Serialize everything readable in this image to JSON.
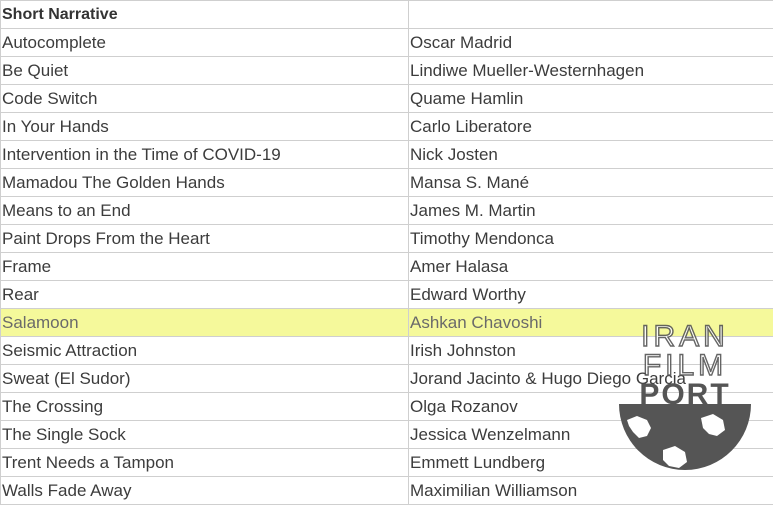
{
  "table": {
    "header": [
      "Short Narrative",
      ""
    ],
    "rows": [
      {
        "title": "Autocomplete",
        "director": "Oscar Madrid"
      },
      {
        "title": "Be Quiet",
        "director": "Lindiwe Mueller-Westernhagen"
      },
      {
        "title": "Code Switch",
        "director": "Quame Hamlin"
      },
      {
        "title": "In Your Hands",
        "director": "Carlo Liberatore"
      },
      {
        "title": "Intervention in the Time of COVID-19",
        "director": "Nick Josten"
      },
      {
        "title": "Mamadou The Golden Hands",
        "director": "Mansa S. Mané"
      },
      {
        "title": "Means to an End",
        "director": "James M. Martin"
      },
      {
        "title": "Paint Drops From the Heart",
        "director": "Timothy Mendonca"
      },
      {
        "title": "Frame",
        "director": "Amer Halasa"
      },
      {
        "title": "Rear",
        "director": "Edward Worthy"
      },
      {
        "title": "Salamoon",
        "director": "Ashkan Chavoshi"
      },
      {
        "title": "Seismic Attraction",
        "director": "Irish Johnston"
      },
      {
        "title": "Sweat (El Sudor)",
        "director": "Jorand Jacinto & Hugo Diego Garcia"
      },
      {
        "title": "The Crossing",
        "director": "Olga Rozanov"
      },
      {
        "title": "The Single Sock",
        "director": "Jessica Wenzelmann"
      },
      {
        "title": "Trent Needs a Tampon",
        "director": "Emmett Lundberg"
      },
      {
        "title": "Walls Fade Away",
        "director": "Maximilian Williamson"
      }
    ],
    "highlight_color": "#f5f99b"
  },
  "watermark": {
    "lines": [
      "IRAN",
      "FILM",
      "PORT"
    ],
    "color": "#555555"
  }
}
